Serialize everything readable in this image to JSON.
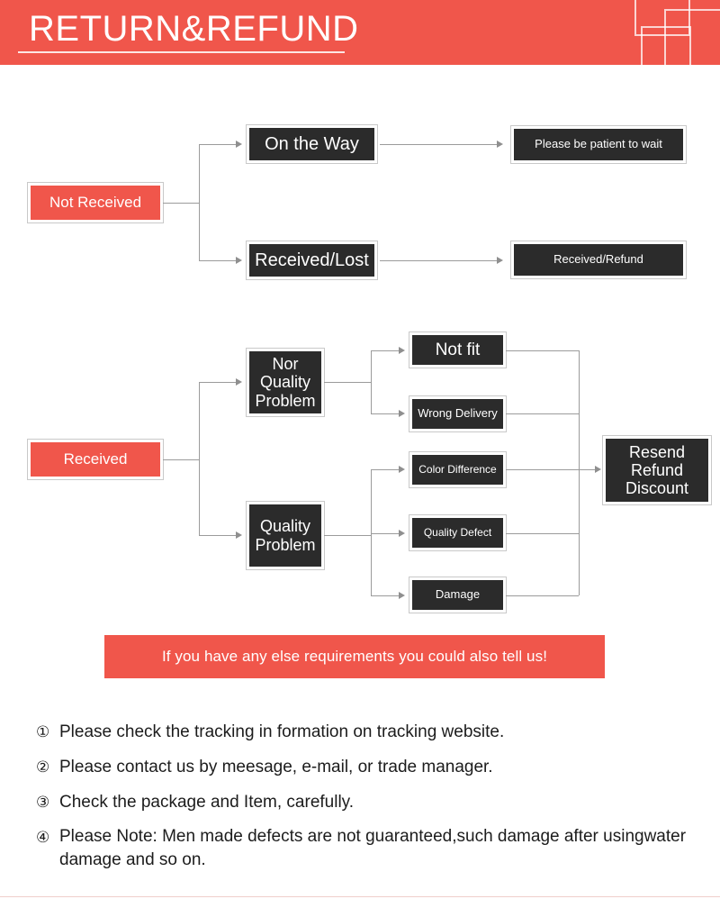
{
  "header": {
    "title": "RETURN&REFUND",
    "accent_color": "#f0564b",
    "decorations": [
      "square-outline",
      "square-outline",
      "square-outline"
    ]
  },
  "flow_not_received": {
    "start": {
      "label": "Not Received",
      "color": "#f0564b"
    },
    "branches": [
      {
        "stage": "On the Way",
        "result": "Please be patient to wait"
      },
      {
        "stage": "Received/Lost",
        "result": "Received/Refund"
      }
    ]
  },
  "flow_received": {
    "start": {
      "label": "Received",
      "color": "#f0564b"
    },
    "categories": [
      {
        "label": "Nor\nQuality\nProblem",
        "label_lines": [
          "Nor",
          "Quality",
          "Problem"
        ],
        "reasons": [
          "Not fit",
          "Wrong Delivery"
        ]
      },
      {
        "label": "Quality\nProblem",
        "label_lines": [
          "Quality",
          "Problem"
        ],
        "reasons": [
          "Color Difference",
          "Quality Defect",
          "Damage"
        ]
      }
    ],
    "reason_boxes": [
      "Not fit",
      "Wrong Delivery",
      "Color Difference",
      "Quality Defect",
      "Damage"
    ],
    "outcome": {
      "label": "Resend\nRefund\nDiscount",
      "label_lines": [
        "Resend",
        "Refund",
        "Discount"
      ]
    }
  },
  "callout": {
    "text": "If you have any else requirements you could also tell us!",
    "color": "#f0564b"
  },
  "notes": [
    {
      "marker": "①",
      "text": "Please check the tracking in formation on tracking website."
    },
    {
      "marker": "②",
      "text": "Please contact us by meesage, e-mail, or trade manager."
    },
    {
      "marker": "③",
      "text": "Check the package and Item, carefully."
    },
    {
      "marker": "④",
      "text": "Please Note: Men made defects are not guaranteed,such damage after usingwater damage and so on."
    }
  ]
}
